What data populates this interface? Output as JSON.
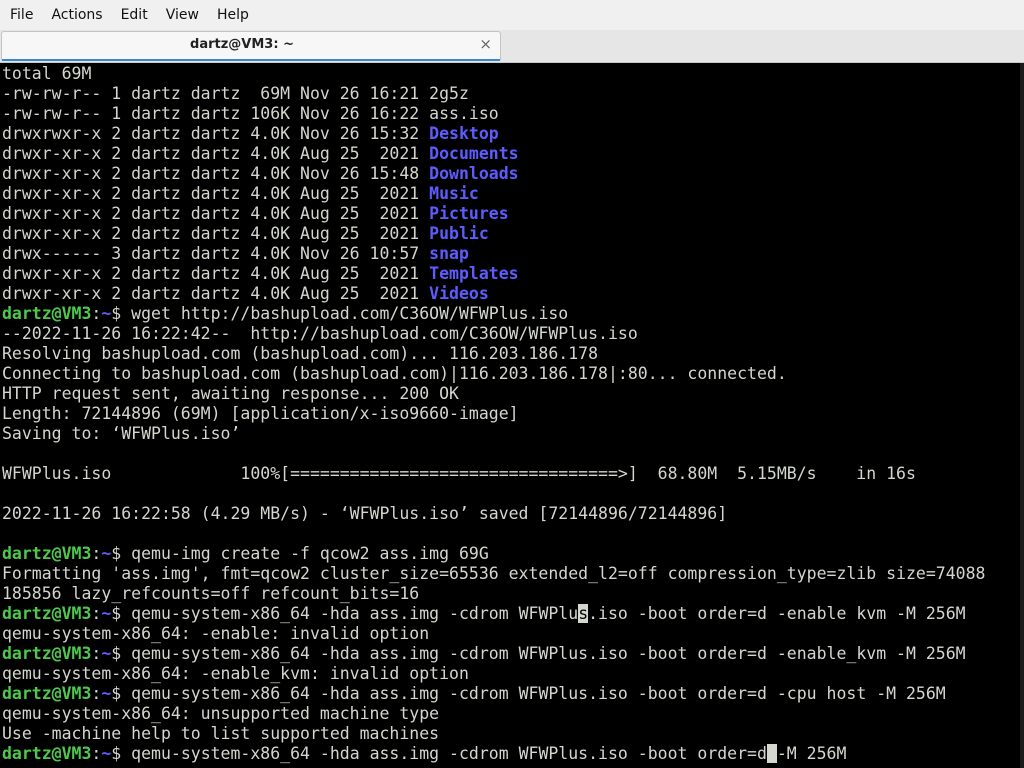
{
  "menubar": {
    "items": [
      "File",
      "Actions",
      "Edit",
      "View",
      "Help"
    ]
  },
  "tab": {
    "title": "dartz@VM3: ~",
    "close": "×"
  },
  "colors": {
    "terminal_bg": "#000000",
    "terminal_fg": "#d3d7cf",
    "prompt_user": "#4ec94e",
    "directory": "#5e5cff"
  },
  "terminal": {
    "prompt": {
      "user": "dartz@VM3",
      "sep": ":",
      "path": "~",
      "symbol": "$ "
    },
    "lines": [
      {
        "t": "plain",
        "text": "total 69M"
      },
      {
        "t": "ls",
        "prefix": "-rw-rw-r-- 1 dartz dartz  69M Nov 26 16:21 ",
        "name": "2g5z",
        "dir": false
      },
      {
        "t": "ls",
        "prefix": "-rw-rw-r-- 1 dartz dartz 106K Nov 26 16:22 ",
        "name": "ass.iso",
        "dir": false
      },
      {
        "t": "ls",
        "prefix": "drwxrwxr-x 2 dartz dartz 4.0K Nov 26 15:32 ",
        "name": "Desktop",
        "dir": true
      },
      {
        "t": "ls",
        "prefix": "drwxr-xr-x 2 dartz dartz 4.0K Aug 25  2021 ",
        "name": "Documents",
        "dir": true
      },
      {
        "t": "ls",
        "prefix": "drwxr-xr-x 2 dartz dartz 4.0K Nov 26 15:48 ",
        "name": "Downloads",
        "dir": true
      },
      {
        "t": "ls",
        "prefix": "drwxr-xr-x 2 dartz dartz 4.0K Aug 25  2021 ",
        "name": "Music",
        "dir": true
      },
      {
        "t": "ls",
        "prefix": "drwxr-xr-x 2 dartz dartz 4.0K Aug 25  2021 ",
        "name": "Pictures",
        "dir": true
      },
      {
        "t": "ls",
        "prefix": "drwxr-xr-x 2 dartz dartz 4.0K Aug 25  2021 ",
        "name": "Public",
        "dir": true
      },
      {
        "t": "ls",
        "prefix": "drwx------ 3 dartz dartz 4.0K Nov 26 10:57 ",
        "name": "snap",
        "dir": true
      },
      {
        "t": "ls",
        "prefix": "drwxr-xr-x 2 dartz dartz 4.0K Aug 25  2021 ",
        "name": "Templates",
        "dir": true
      },
      {
        "t": "ls",
        "prefix": "drwxr-xr-x 2 dartz dartz 4.0K Aug 25  2021 ",
        "name": "Videos",
        "dir": true
      },
      {
        "t": "cmd",
        "text": "wget http://bashupload.com/C36OW/WFWPlus.iso"
      },
      {
        "t": "plain",
        "text": "--2022-11-26 16:22:42--  http://bashupload.com/C36OW/WFWPlus.iso"
      },
      {
        "t": "plain",
        "text": "Resolving bashupload.com (bashupload.com)... 116.203.186.178"
      },
      {
        "t": "plain",
        "text": "Connecting to bashupload.com (bashupload.com)|116.203.186.178|:80... connected."
      },
      {
        "t": "plain",
        "text": "HTTP request sent, awaiting response... 200 OK"
      },
      {
        "t": "plain",
        "text": "Length: 72144896 (69M) [application/x-iso9660-image]"
      },
      {
        "t": "plain",
        "text": "Saving to: ‘WFWPlus.iso’"
      },
      {
        "t": "plain",
        "text": ""
      },
      {
        "t": "plain",
        "text": "WFWPlus.iso             100%[=================================>]  68.80M  5.15MB/s    in 16s"
      },
      {
        "t": "plain",
        "text": ""
      },
      {
        "t": "plain",
        "text": "2022-11-26 16:22:58 (4.29 MB/s) - ‘WFWPlus.iso’ saved [72144896/72144896]"
      },
      {
        "t": "plain",
        "text": ""
      },
      {
        "t": "cmd",
        "text": "qemu-img create -f qcow2 ass.img 69G"
      },
      {
        "t": "plain",
        "text": "Formatting 'ass.img', fmt=qcow2 cluster_size=65536 extended_l2=off compression_type=zlib size=74088"
      },
      {
        "t": "plain",
        "text": "185856 lazy_refcounts=off refcount_bits=16"
      },
      {
        "t": "cmd",
        "pre": "qemu-system-x86_64 -hda ass.img -cdrom WFWPlu",
        "cur": "s",
        "post": ".iso -boot order=d -enable kvm -M 256M"
      },
      {
        "t": "plain",
        "text": "qemu-system-x86_64: -enable: invalid option"
      },
      {
        "t": "cmd",
        "text": "qemu-system-x86_64 -hda ass.img -cdrom WFWPlus.iso -boot order=d -enable_kvm -M 256M"
      },
      {
        "t": "plain",
        "text": "qemu-system-x86_64: -enable_kvm: invalid option"
      },
      {
        "t": "cmd",
        "text": "qemu-system-x86_64 -hda ass.img -cdrom WFWPlus.iso -boot order=d -cpu host -M 256M"
      },
      {
        "t": "plain",
        "text": "qemu-system-x86_64: unsupported machine type"
      },
      {
        "t": "plain",
        "text": "Use -machine help to list supported machines"
      },
      {
        "t": "cmd",
        "pre": "qemu-system-x86_64 -hda ass.img -cdrom WFWPlus.iso -boot order=d",
        "cur": " ",
        "post": "-M 256M"
      }
    ]
  }
}
